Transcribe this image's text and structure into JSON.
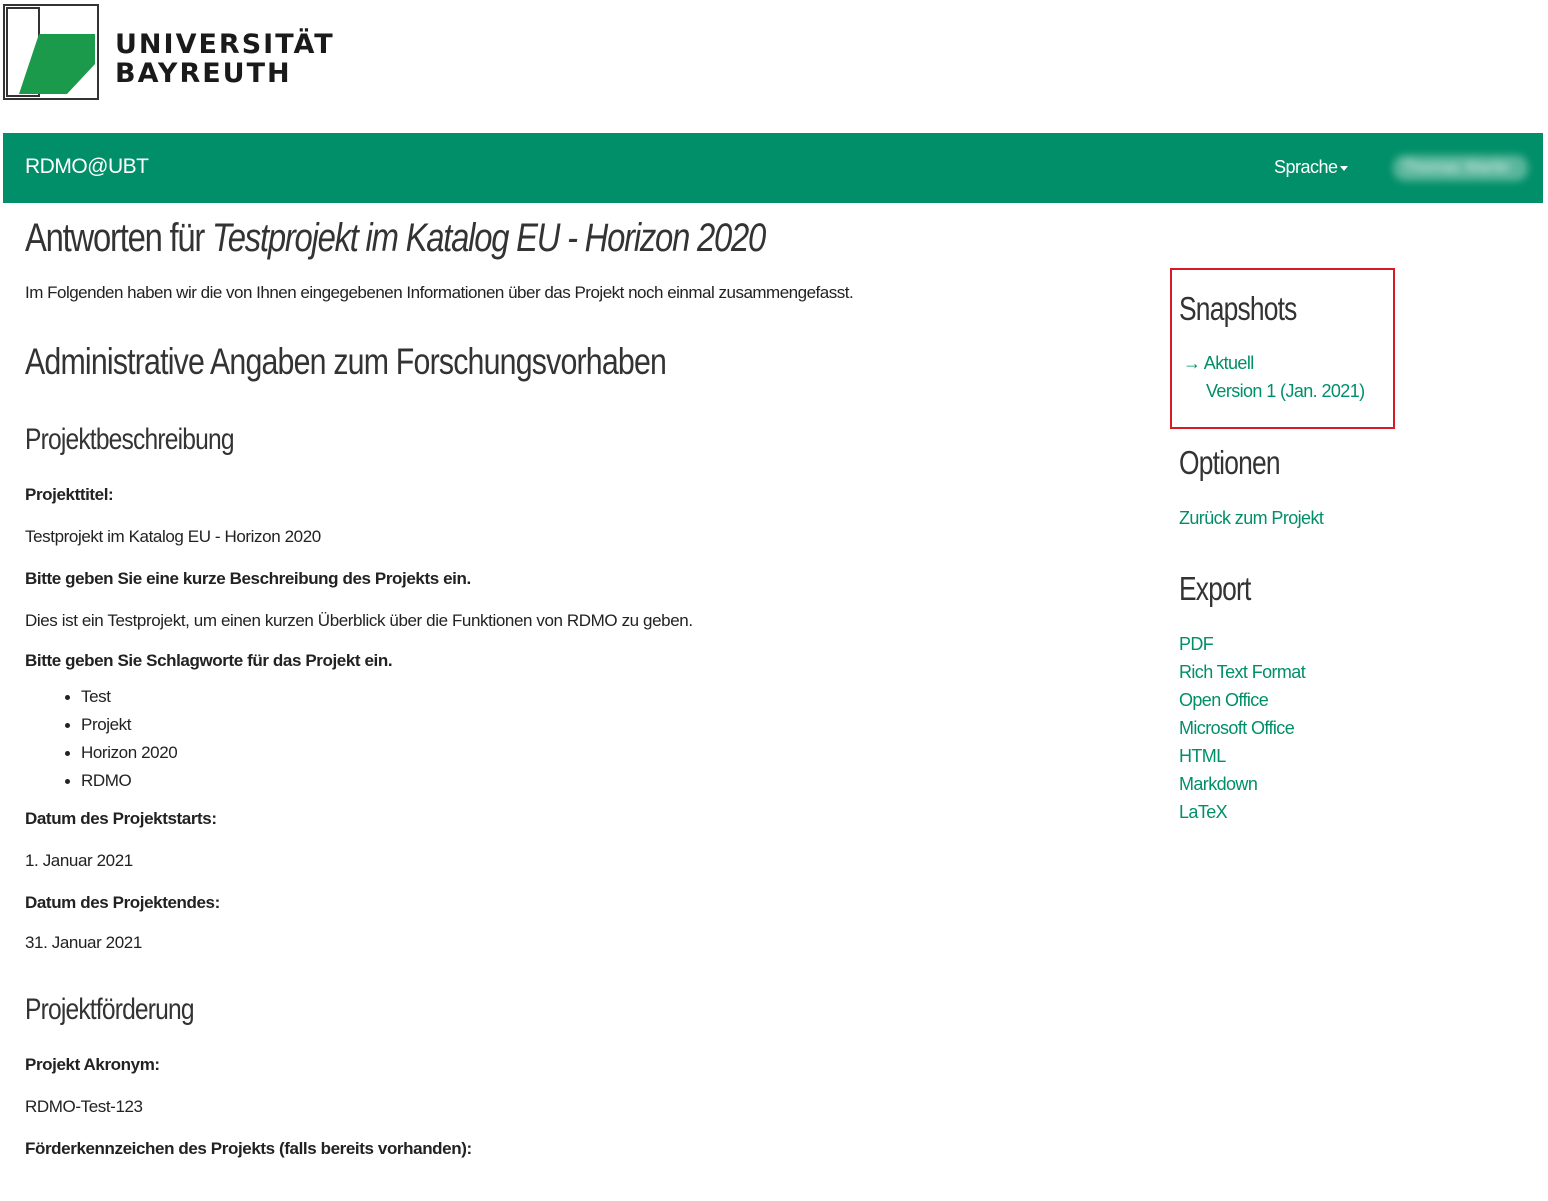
{
  "logo": {
    "line1": "UNIVERSITÄT",
    "line2": "BAYREUTH"
  },
  "navbar": {
    "brand": "RDMO@UBT",
    "language_label": "Sprache",
    "user_name": "Thomas Martin"
  },
  "page": {
    "title_prefix": "Antworten für ",
    "title_project": "Testprojekt im Katalog EU - Horizon 2020",
    "intro": "Im Folgenden haben wir die von Ihnen eingegebenen Informationen über das Projekt noch einmal zusammengefasst."
  },
  "section": {
    "title": "Administrative Angaben zum Forschungsvorhaben",
    "subsection1": {
      "title": "Projektbeschreibung",
      "q_title": "Projekttitel:",
      "a_title": "Testprojekt im Katalog EU - Horizon 2020",
      "q_description": "Bitte geben Sie eine kurze Beschreibung des Projekts ein.",
      "a_description": "Dies ist ein Testprojekt, um einen kurzen Überblick über die Funktionen von RDMO zu geben.",
      "q_keywords": "Bitte geben Sie Schlagworte für das Projekt ein.",
      "keywords": [
        "Test",
        "Projekt",
        "Horizon 2020",
        "RDMO"
      ],
      "q_start": "Datum des Projektstarts:",
      "a_start": "1. Januar 2021",
      "q_end": "Datum des Projektendes:",
      "a_end": "31. Januar 2021"
    },
    "subsection2": {
      "title": "Projektförderung",
      "q_acronym": "Projekt Akronym:",
      "a_acronym": "RDMO-Test-123",
      "q_grant": "Förderkennzeichen des Projekts (falls bereits vorhanden):"
    }
  },
  "sidebar": {
    "snapshots_title": "Snapshots",
    "snapshot_current": "→ Aktuell",
    "snapshot_version1": "Version 1 (Jan. 2021)",
    "options_title": "Optionen",
    "back_link": "Zurück zum Projekt",
    "export_title": "Export",
    "export_links": [
      "PDF",
      "Rich Text Format",
      "Open Office",
      "Microsoft Office",
      "HTML",
      "Markdown",
      "LaTeX"
    ]
  },
  "colors": {
    "brand_green": "#008f68",
    "highlight_red": "#d51b27"
  }
}
